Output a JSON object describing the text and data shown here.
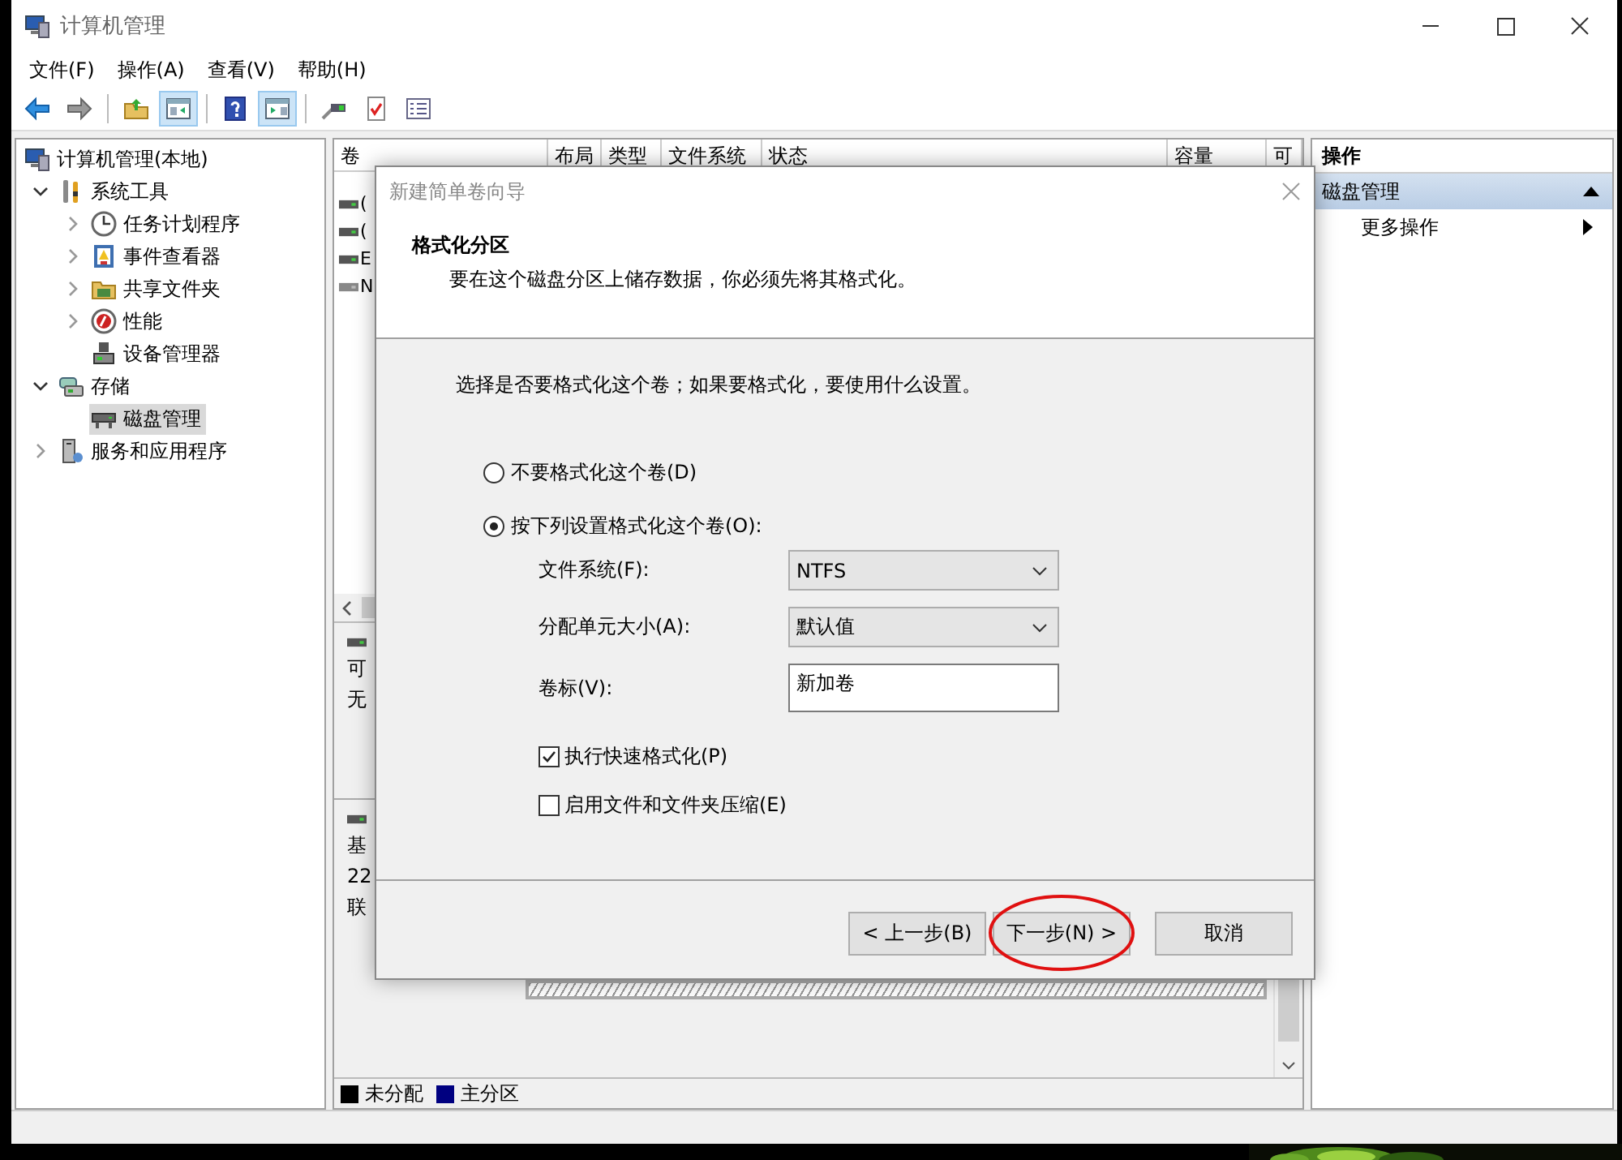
{
  "window": {
    "title": "计算机管理"
  },
  "menu": [
    "文件(F)",
    "操作(A)",
    "查看(V)",
    "帮助(H)"
  ],
  "toolbar": [
    {
      "kind": "back",
      "pressed": false
    },
    {
      "kind": "forward",
      "pressed": false
    },
    {
      "kind": "separator"
    },
    {
      "kind": "up",
      "pressed": false
    },
    {
      "kind": "tree-toggle",
      "pressed": true
    },
    {
      "kind": "separator"
    },
    {
      "kind": "help",
      "pressed": false
    },
    {
      "kind": "pane-toggle",
      "pressed": true
    },
    {
      "kind": "separator"
    },
    {
      "kind": "connect",
      "pressed": false
    },
    {
      "kind": "check",
      "pressed": false
    },
    {
      "kind": "list",
      "pressed": false
    }
  ],
  "tree": {
    "items": [
      {
        "label": "计算机管理(本地)",
        "kind": "computer",
        "selected": false,
        "children": [
          {
            "label": "系统工具",
            "kind": "tools",
            "expanded": true,
            "selected": false,
            "children": [
              {
                "label": "任务计划程序",
                "kind": "clock",
                "expanded": false,
                "selected": false
              },
              {
                "label": "事件查看器",
                "kind": "log",
                "expanded": false,
                "selected": false
              },
              {
                "label": "共享文件夹",
                "kind": "folder",
                "expanded": false,
                "selected": false
              },
              {
                "label": "性能",
                "kind": "gauge",
                "expanded": false,
                "selected": false
              },
              {
                "label": "设备管理器",
                "kind": "device",
                "selected": false
              }
            ]
          },
          {
            "label": "存储",
            "kind": "storage",
            "expanded": true,
            "selected": false,
            "children": [
              {
                "label": "磁盘管理",
                "kind": "disk",
                "selected": true
              }
            ]
          },
          {
            "label": "服务和应用程序",
            "kind": "server",
            "expanded": false,
            "selected": false
          }
        ]
      }
    ]
  },
  "volume_list": {
    "columns": [
      "卷",
      "布局",
      "类型",
      "文件系统",
      "状态",
      "容量",
      "可"
    ],
    "rows": [
      {
        "name": "(",
        "kind": "online"
      },
      {
        "name": "(",
        "kind": "online"
      },
      {
        "name": "E",
        "kind": "online"
      },
      {
        "name": "N",
        "kind": "offline"
      }
    ]
  },
  "disk_panel": {
    "disks": [
      {
        "lines": [
          "可",
          "无"
        ]
      },
      {
        "lines": [
          "基",
          "22",
          "联"
        ]
      }
    ],
    "legend": [
      {
        "label": "未分配",
        "color": "#000000"
      },
      {
        "label": "主分区",
        "color": "#000080"
      }
    ]
  },
  "actions": {
    "title": "操作",
    "sections": [
      {
        "label": "磁盘管理",
        "expanded": true,
        "items": [
          "更多操作"
        ]
      }
    ]
  },
  "dialog": {
    "title": "新建简单卷向导",
    "heading": "格式化分区",
    "subheading": "要在这个磁盘分区上储存数据，你必须先将其格式化。",
    "prompt": "选择是否要格式化这个卷；如果要格式化，要使用什么设置。",
    "options": [
      {
        "label": "不要格式化这个卷(D)",
        "selected": false
      },
      {
        "label": "按下列设置格式化这个卷(O):",
        "selected": true
      }
    ],
    "fields": [
      {
        "kind": "dropdown",
        "label": "文件系统(F):",
        "value": "NTFS"
      },
      {
        "kind": "dropdown",
        "label": "分配单元大小(A):",
        "value": "默认值"
      },
      {
        "kind": "text",
        "label": "卷标(V):",
        "value": "新加卷"
      }
    ],
    "checkboxes": [
      {
        "label": "执行快速格式化(P)",
        "checked": true
      },
      {
        "label": "启用文件和文件夹压缩(E)",
        "checked": false
      }
    ],
    "buttons": [
      {
        "label": "< 上一步(B)",
        "highlighted": false
      },
      {
        "label": "下一步(N) >",
        "highlighted": true
      },
      {
        "label": "取消",
        "highlighted": false
      }
    ]
  },
  "desktop": {
    "kind": "picture"
  }
}
